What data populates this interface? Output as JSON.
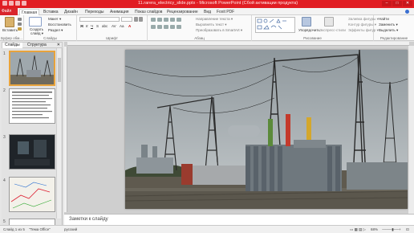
{
  "window": {
    "title": "11.rarera_electricy_slide.pptx - Microsoft PowerPoint (Сбой активации продукта)",
    "controls": [
      "–",
      "□",
      "✕"
    ]
  },
  "tabs": [
    "Файл",
    "Главная",
    "Вставка",
    "Дизайн",
    "Переходы",
    "Анимация",
    "Показ слайдов",
    "Рецензирование",
    "Вид",
    "Foxit PDF"
  ],
  "ribbon": {
    "clipboard": {
      "paste": "Вставить",
      "label": "Буфер обм..."
    },
    "slides": {
      "create": "Создать",
      "create2": "слайд ▾",
      "layout": "Макет ▾",
      "restore": "Восстановить",
      "section": "Раздел ▾",
      "label": "Слайды"
    },
    "font": {
      "label": "Шрифт"
    },
    "paragraph": {
      "label": "Абзац",
      "direction": "Направление текста ▾",
      "align": "Выровнять текст ▾",
      "smartart": "Преобразовать в SmartArt ▾"
    },
    "drawing": {
      "arrange": "Упорядочить",
      "styles": "Экспресс-стили",
      "fill": "Заливка фигуры ▾",
      "outline": "Контур фигуры ▾",
      "effects": "Эффекты фигур ▾",
      "label": "Рисование"
    },
    "editing": {
      "find": "Найти",
      "replace": "Заменить ▾",
      "select": "Выделить ▾",
      "label": "Редактирование"
    }
  },
  "pane": {
    "tab_slides": "Слайды",
    "tab_outline": "Структура",
    "numbers": [
      "1",
      "2",
      "3",
      "4",
      "5"
    ]
  },
  "notes": {
    "placeholder": "Заметки к слайду"
  },
  "status": {
    "slide": "Слайд 1 из 5",
    "theme": "\"Тема Office\"",
    "lang": "русский",
    "zoom": "68%"
  },
  "colors": {
    "accent": "#e11d23",
    "file_tab": "#d9262c",
    "selected_thumb": "#e8a33c"
  }
}
